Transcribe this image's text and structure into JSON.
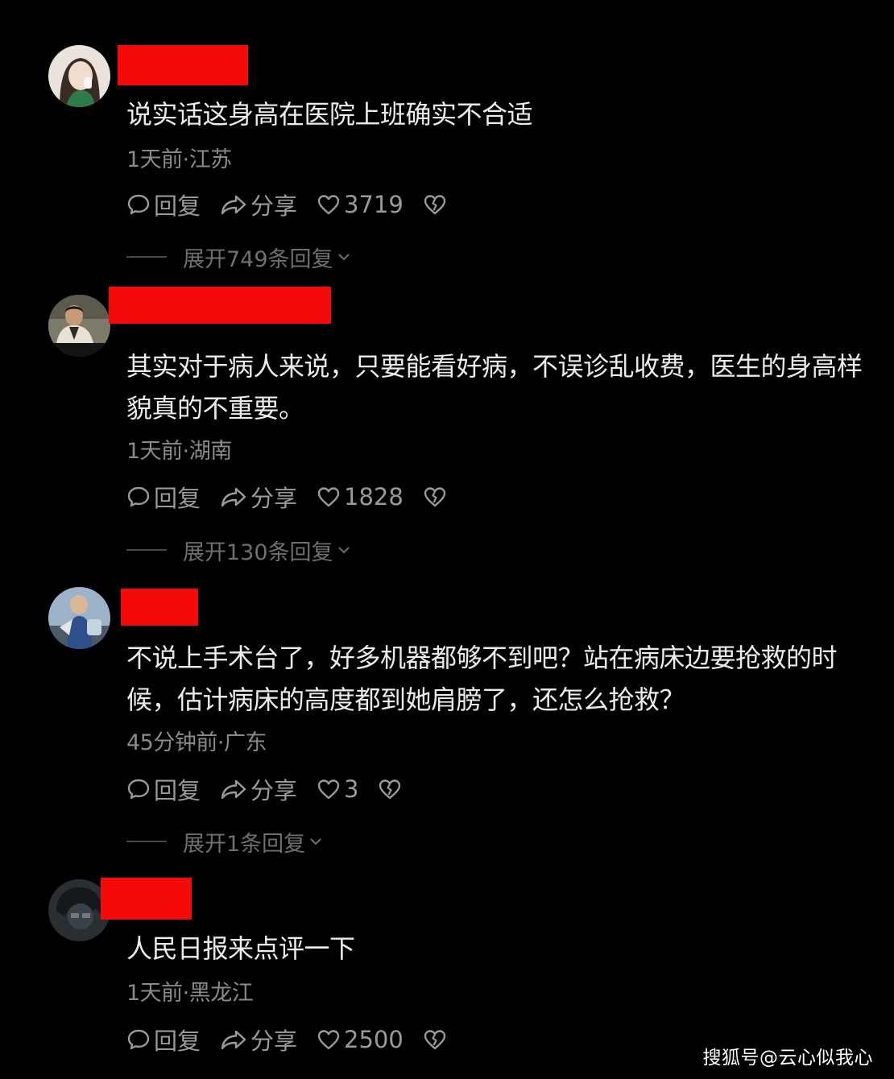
{
  "comments": [
    {
      "text": "说实话这身高在医院上班确实不合适",
      "meta": "1天前·江苏",
      "reply_label": "回复",
      "share_label": "分享",
      "likes": "3719",
      "expand_label": "展开749条回复"
    },
    {
      "text": "其实对于病人来说，只要能看好病，不误诊乱收费，医生的身高样貌真的不重要。",
      "meta": "1天前·湖南",
      "reply_label": "回复",
      "share_label": "分享",
      "likes": "1828",
      "expand_label": "展开130条回复"
    },
    {
      "text": "不说上手术台了，好多机器都够不到吧？站在病床边要抢救的时候，估计病床的高度都到她肩膀了，还怎么抢救？",
      "meta": "45分钟前·广东",
      "reply_label": "回复",
      "share_label": "分享",
      "likes": "3",
      "expand_label": "展开1条回复"
    },
    {
      "text": "人民日报来点评一下",
      "meta": "1天前·黑龙江",
      "reply_label": "回复",
      "share_label": "分享",
      "likes": "2500"
    }
  ],
  "watermark": "搜狐号@云心似我心",
  "colors": {
    "background": "#000000",
    "redaction": "#f50a0a",
    "body_text": "#ececec",
    "meta_text": "#8a8a8a"
  },
  "icons": {
    "reply": "comment-bubble-icon",
    "share": "share-arrow-icon",
    "like": "heart-icon",
    "dislike": "broken-heart-icon",
    "expand": "chevron-down-icon"
  }
}
